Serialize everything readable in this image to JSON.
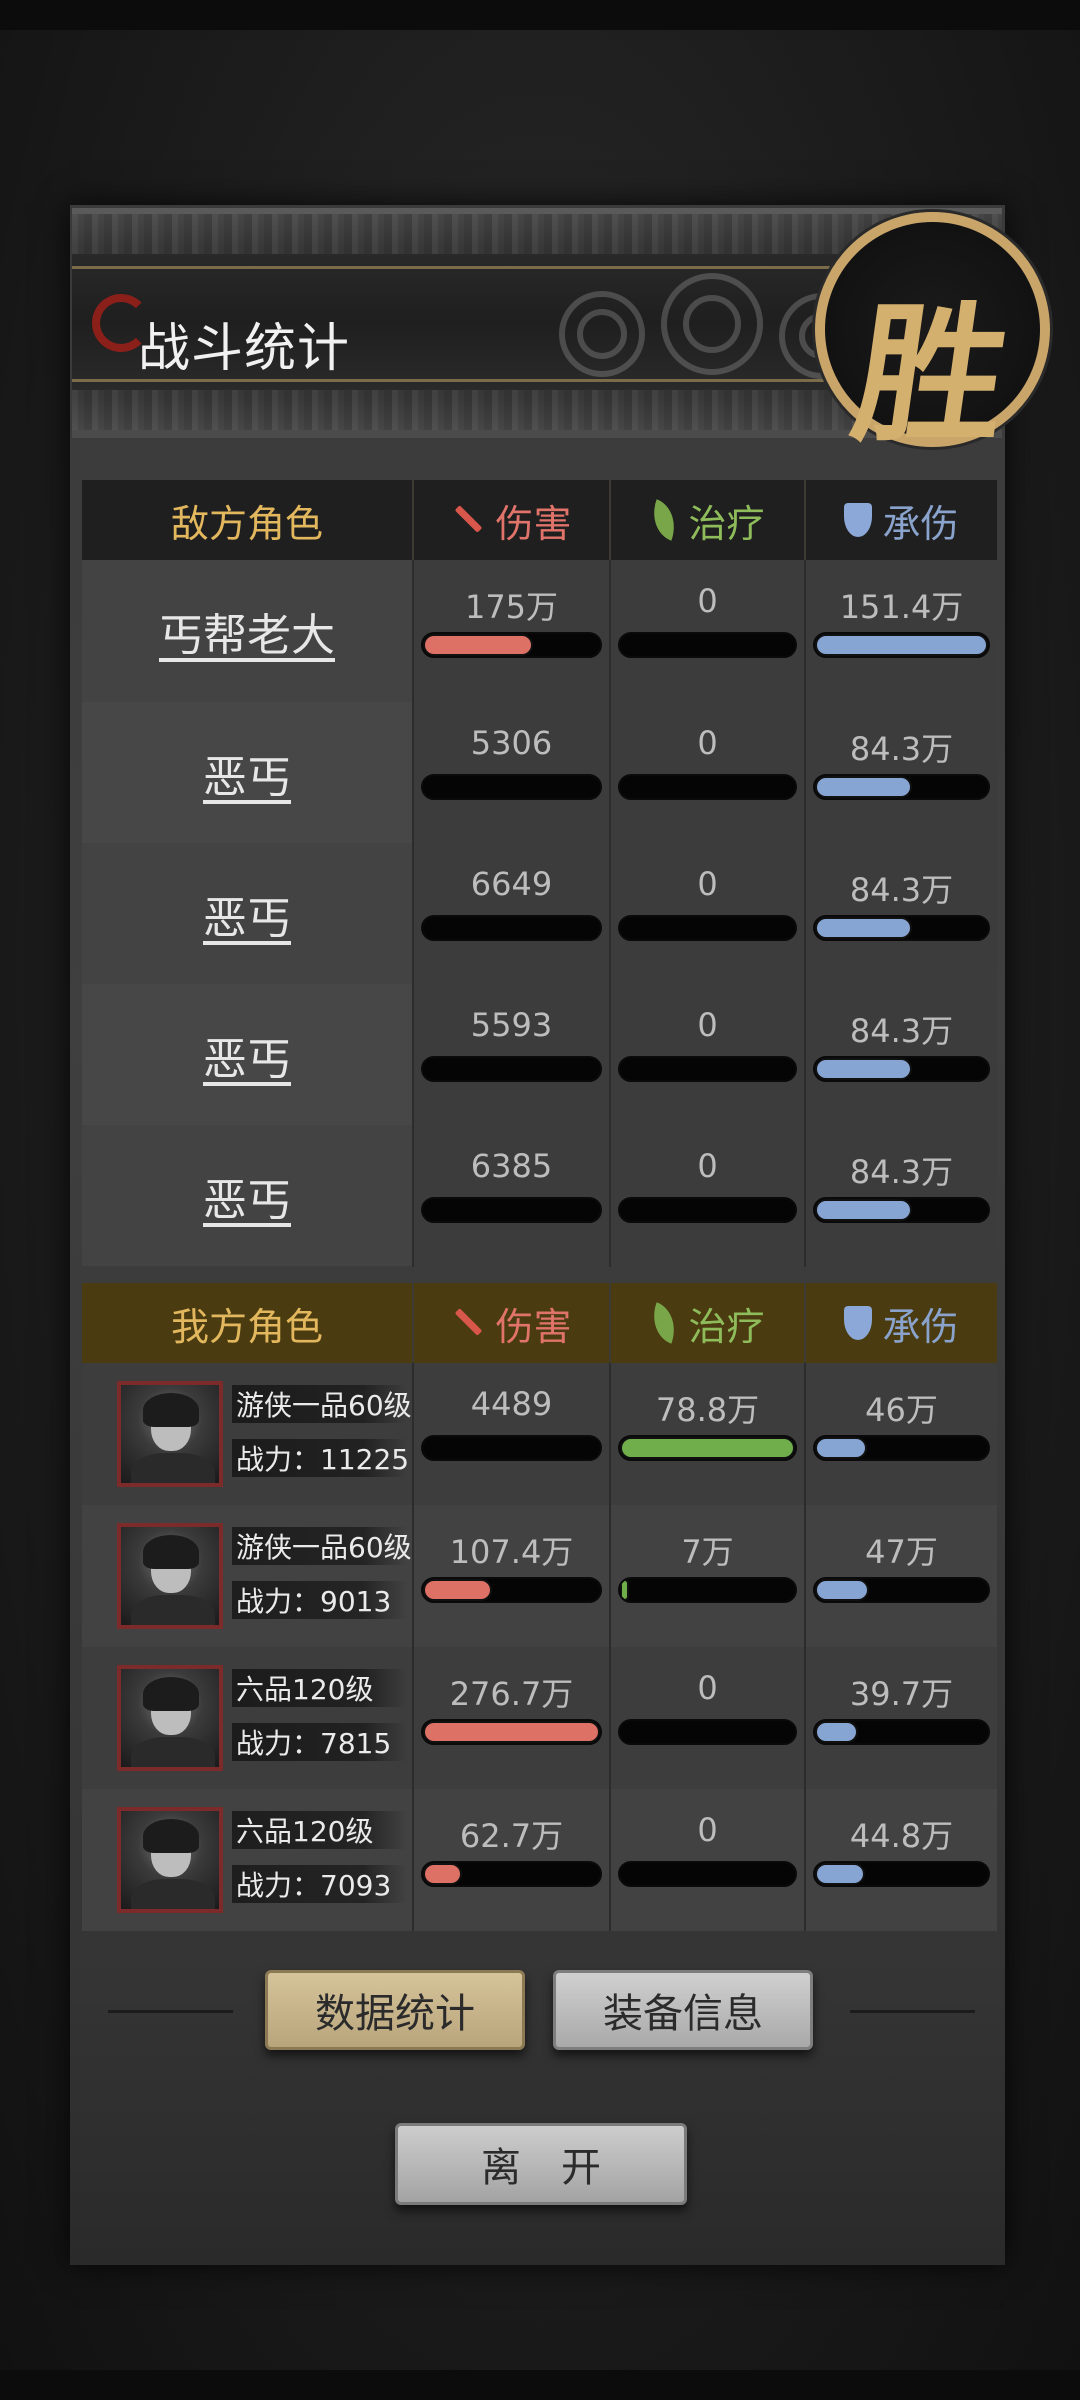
{
  "title": "战斗统计",
  "victory_glyph": "胜",
  "columns": {
    "damage": "伤害",
    "heal": "治疗",
    "tank": "承伤"
  },
  "enemy": {
    "header": "敌方角色",
    "rows": [
      {
        "name": "丐帮老大",
        "damage": "175万",
        "heal": "0",
        "tank": "151.4万",
        "damage_fill": 0.62,
        "heal_fill": 0,
        "tank_fill": 1.0
      },
      {
        "name": "恶丐",
        "damage": "5306",
        "heal": "0",
        "tank": "84.3万",
        "damage_fill": 0.0,
        "heal_fill": 0,
        "tank_fill": 0.56
      },
      {
        "name": "恶丐",
        "damage": "6649",
        "heal": "0",
        "tank": "84.3万",
        "damage_fill": 0.0,
        "heal_fill": 0,
        "tank_fill": 0.56
      },
      {
        "name": "恶丐",
        "damage": "5593",
        "heal": "0",
        "tank": "84.3万",
        "damage_fill": 0.0,
        "heal_fill": 0,
        "tank_fill": 0.56
      },
      {
        "name": "恶丐",
        "damage": "6385",
        "heal": "0",
        "tank": "84.3万",
        "damage_fill": 0.0,
        "heal_fill": 0,
        "tank_fill": 0.56
      }
    ]
  },
  "ally": {
    "header": "我方角色",
    "rows": [
      {
        "rank": "游侠一品60级",
        "power": "战力：11225",
        "damage": "4489",
        "heal": "78.8万",
        "tank": "46万",
        "damage_fill": 0.0,
        "heal_fill": 1.0,
        "tank_fill": 0.3
      },
      {
        "rank": "游侠一品60级",
        "power": "战力：9013",
        "damage": "107.4万",
        "heal": "7万",
        "tank": "47万",
        "damage_fill": 0.39,
        "heal_fill": 0.05,
        "tank_fill": 0.31
      },
      {
        "rank": "六品120级",
        "power": "战力：7815",
        "damage": "276.7万",
        "heal": "0",
        "tank": "39.7万",
        "damage_fill": 1.0,
        "heal_fill": 0,
        "tank_fill": 0.25
      },
      {
        "rank": "六品120级",
        "power": "战力：7093",
        "damage": "62.7万",
        "heal": "0",
        "tank": "44.8万",
        "damage_fill": 0.22,
        "heal_fill": 0,
        "tank_fill": 0.29
      }
    ]
  },
  "buttons": {
    "stats": "数据统计",
    "equip": "装备信息",
    "leave": "离开"
  },
  "colors": {
    "damage": "#de7166",
    "heal": "#6fae4a",
    "tank": "#87a5d3",
    "accent_gold": "#e2b75d"
  }
}
